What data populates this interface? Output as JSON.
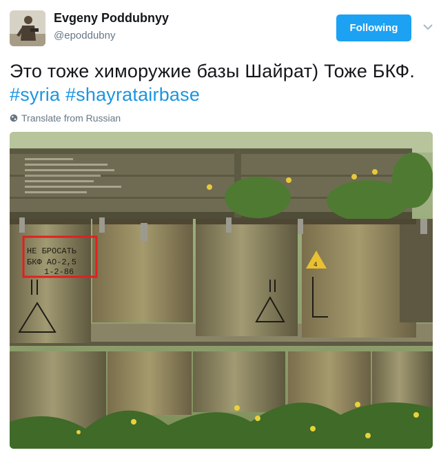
{
  "user": {
    "display_name": "Evgeny Poddubnyy",
    "handle": "@epoddubny"
  },
  "follow_button": {
    "label": "Following",
    "color": "#1da1f2"
  },
  "tweet": {
    "text": "Это тоже химоружие базы Шайрат) Тоже БКФ.",
    "hashtags": [
      "#syria",
      "#shayratairbase"
    ],
    "hashtag_color": "#1b95e0"
  },
  "translate": {
    "label": "Translate from Russian",
    "icon": "globe-icon"
  },
  "media": {
    "stencil_line1": "НЕ БРОСАТЬ",
    "stencil_line2": "БКФ АО-2,5",
    "stencil_line3": "1-2-86",
    "highlight_color": "#e02020"
  },
  "icons": {
    "menu": "chevron-down-icon"
  }
}
